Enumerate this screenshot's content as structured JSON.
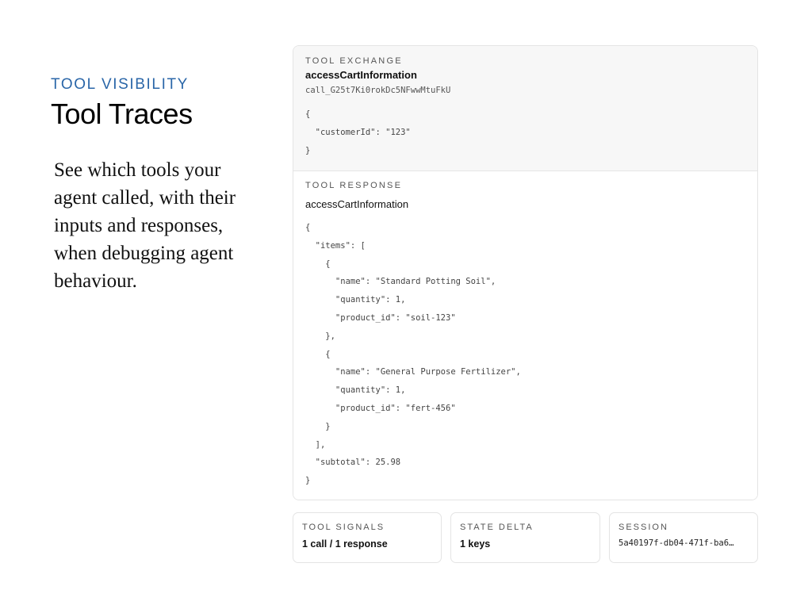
{
  "intro": {
    "eyebrow": "TOOL VISIBILITY",
    "title": "Tool Traces",
    "description": "See which tools your agent called, with their inputs and responses, when debugging agent behaviour."
  },
  "exchange": {
    "label": "TOOL EXCHANGE",
    "tool_name": "accessCartInformation",
    "call_id": "call_G25t7Ki0rokDc5NFwwMtuFkU",
    "input": "{\n  \"customerId\": \"123\"\n}"
  },
  "response": {
    "label": "TOOL RESPONSE",
    "tool_name": "accessCartInformation",
    "output": "{\n  \"items\": [\n    {\n      \"name\": \"Standard Potting Soil\",\n      \"quantity\": 1,\n      \"product_id\": \"soil-123\"\n    },\n    {\n      \"name\": \"General Purpose Fertilizer\",\n      \"quantity\": 1,\n      \"product_id\": \"fert-456\"\n    }\n  ],\n  \"subtotal\": 25.98\n}"
  },
  "cards": {
    "signals": {
      "label": "TOOL SIGNALS",
      "value": "1 call / 1 response"
    },
    "state": {
      "label": "STATE DELTA",
      "value": "1 keys"
    },
    "session": {
      "label": "SESSION",
      "value": "5a40197f-db04-471f-ba6…"
    }
  }
}
